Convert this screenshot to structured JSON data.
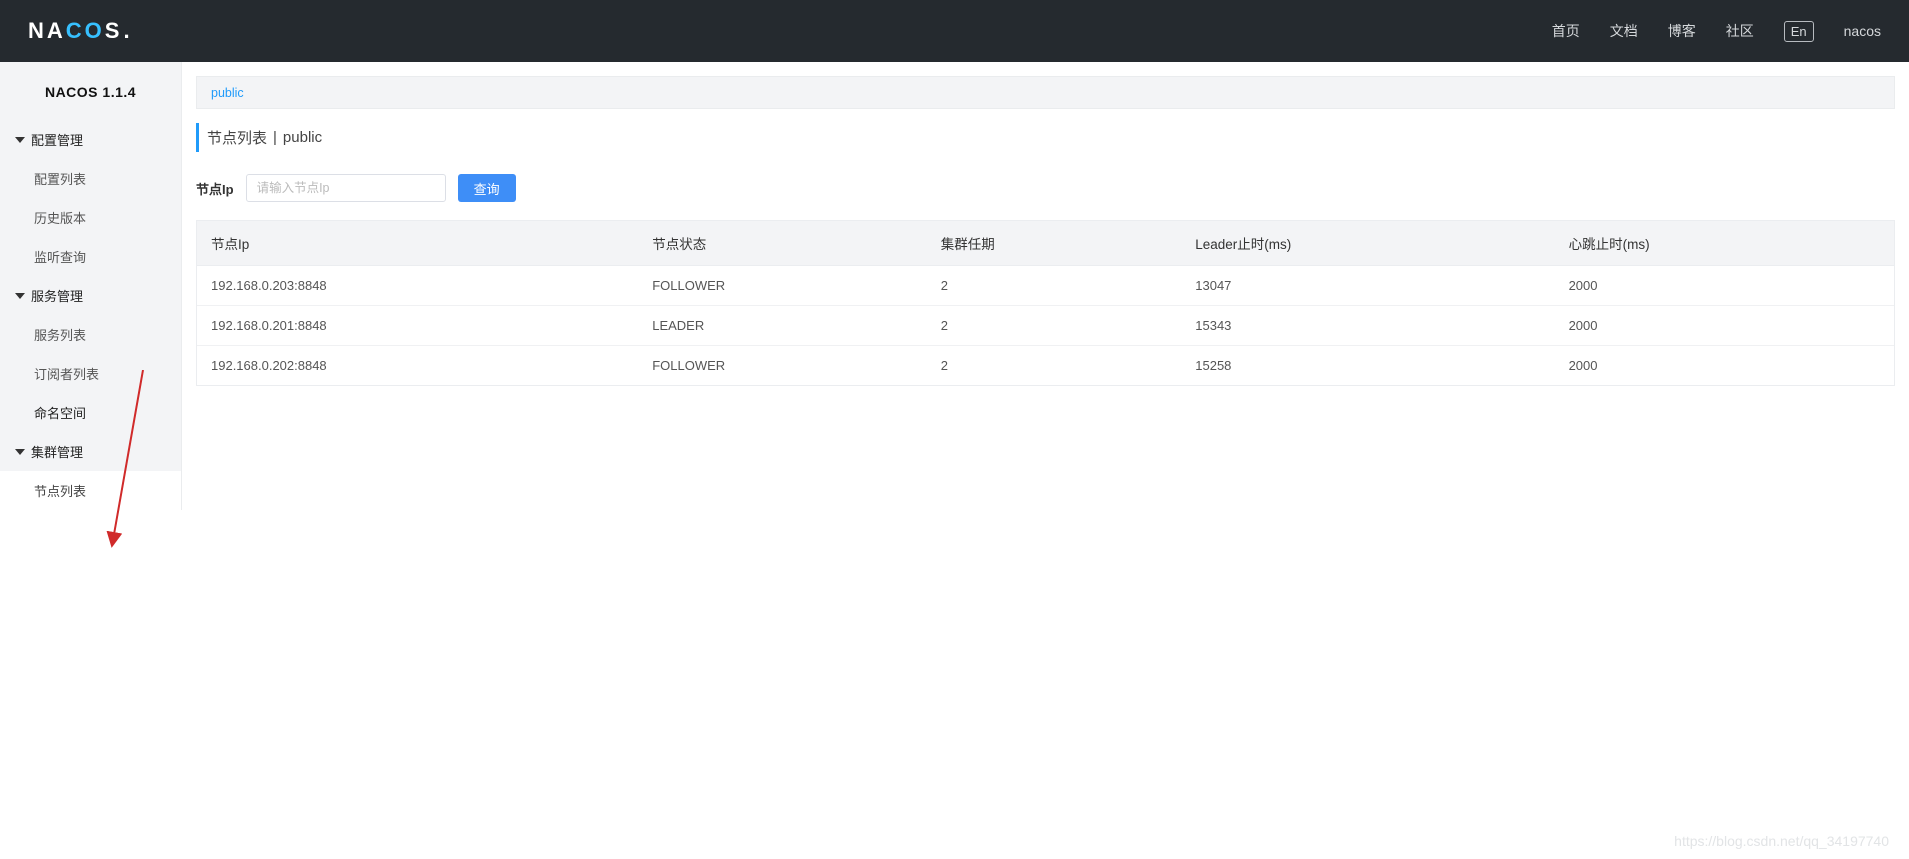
{
  "header": {
    "logo_parts": {
      "n": "N",
      "a1": "A",
      "c": "C",
      "o": "O",
      "s": "S",
      "dot": "."
    },
    "nav": {
      "home": "首页",
      "docs": "文档",
      "blog": "博客",
      "community": "社区",
      "lang": "En",
      "user": "nacos"
    }
  },
  "sidebar": {
    "title": "NACOS 1.1.4",
    "groups": {
      "config": {
        "label": "配置管理",
        "items": {
          "configList": "配置列表",
          "history": "历史版本",
          "listen": "监听查询"
        }
      },
      "service": {
        "label": "服务管理",
        "items": {
          "serviceList": "服务列表",
          "subscribers": "订阅者列表"
        }
      },
      "namespace": {
        "label": "命名空间"
      },
      "cluster": {
        "label": "集群管理",
        "items": {
          "nodeList": "节点列表"
        }
      }
    }
  },
  "tabs": {
    "public": "public"
  },
  "page": {
    "title": "节点列表",
    "sep": "|",
    "scope": "public"
  },
  "toolbar": {
    "ipLabel": "节点Ip",
    "ipPlaceholder": "请输入节点Ip",
    "queryBtn": "查询"
  },
  "table": {
    "headers": {
      "ip": "节点Ip",
      "state": "节点状态",
      "term": "集群任期",
      "leaderDue": "Leader止时(ms)",
      "heartbeat": "心跳止时(ms)"
    },
    "rows": [
      {
        "ip": "192.168.0.203:8848",
        "state": "FOLLOWER",
        "term": "2",
        "leaderDue": "13047",
        "heartbeat": "2000"
      },
      {
        "ip": "192.168.0.201:8848",
        "state": "LEADER",
        "term": "2",
        "leaderDue": "15343",
        "heartbeat": "2000"
      },
      {
        "ip": "192.168.0.202:8848",
        "state": "FOLLOWER",
        "term": "2",
        "leaderDue": "15258",
        "heartbeat": "2000"
      }
    ]
  },
  "watermark": "https://blog.csdn.net/qq_34197740"
}
